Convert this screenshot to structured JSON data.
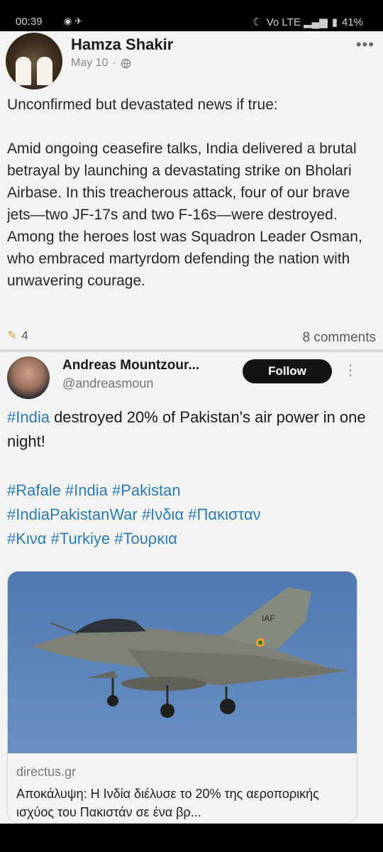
{
  "status_bar": {
    "time": "00:39",
    "notif_icons": "◉ ✈",
    "signal": "Vo LTE ▂▄▆",
    "battery": "41%"
  },
  "fb_post": {
    "author": "Hamza Shakir",
    "date": "May 10",
    "audience_icon": "globe-icon",
    "text": "Unconfirmed but devastated news if true:\n\nAmid ongoing ceasefire talks, India delivered a brutal betrayal by launching a devastating strike on Bholari Airbase. In this treacherous attack, four of our brave jets—two JF-17s and two F-16s—were destroyed. Among the heroes lost was Squadron Leader Osman, who embraced martyrdom defending the nation with unwavering courage.",
    "reactions": "4",
    "comments": "8 comments"
  },
  "tw_post": {
    "author": "Andreas Mountzour...",
    "handle": "@andreasmoun",
    "follow_label": "Follow",
    "text_tag": "#India",
    "text_rest": " destroyed 20% of Pakistan's air power in one night!",
    "hashtags_line1": "#Rafale #India #Pakistan",
    "hashtags_line2": "#IndiaPakistanWar #Ινδια #Πακισταν",
    "hashtags_line3": "#Κινα #Turkiye #Τουρκια",
    "card": {
      "domain": "directus.gr",
      "title": "Αποκάλυψη: Η Ινδία διέλυσε το 20% της αεροπορικής ισχύος του Πακιστάν σε ένα βρ...",
      "image_fin_text": "IAF"
    }
  },
  "colors": {
    "hashtag": "#2b7ab8",
    "follow_bg": "#141414",
    "sky": "#5b83b6"
  }
}
